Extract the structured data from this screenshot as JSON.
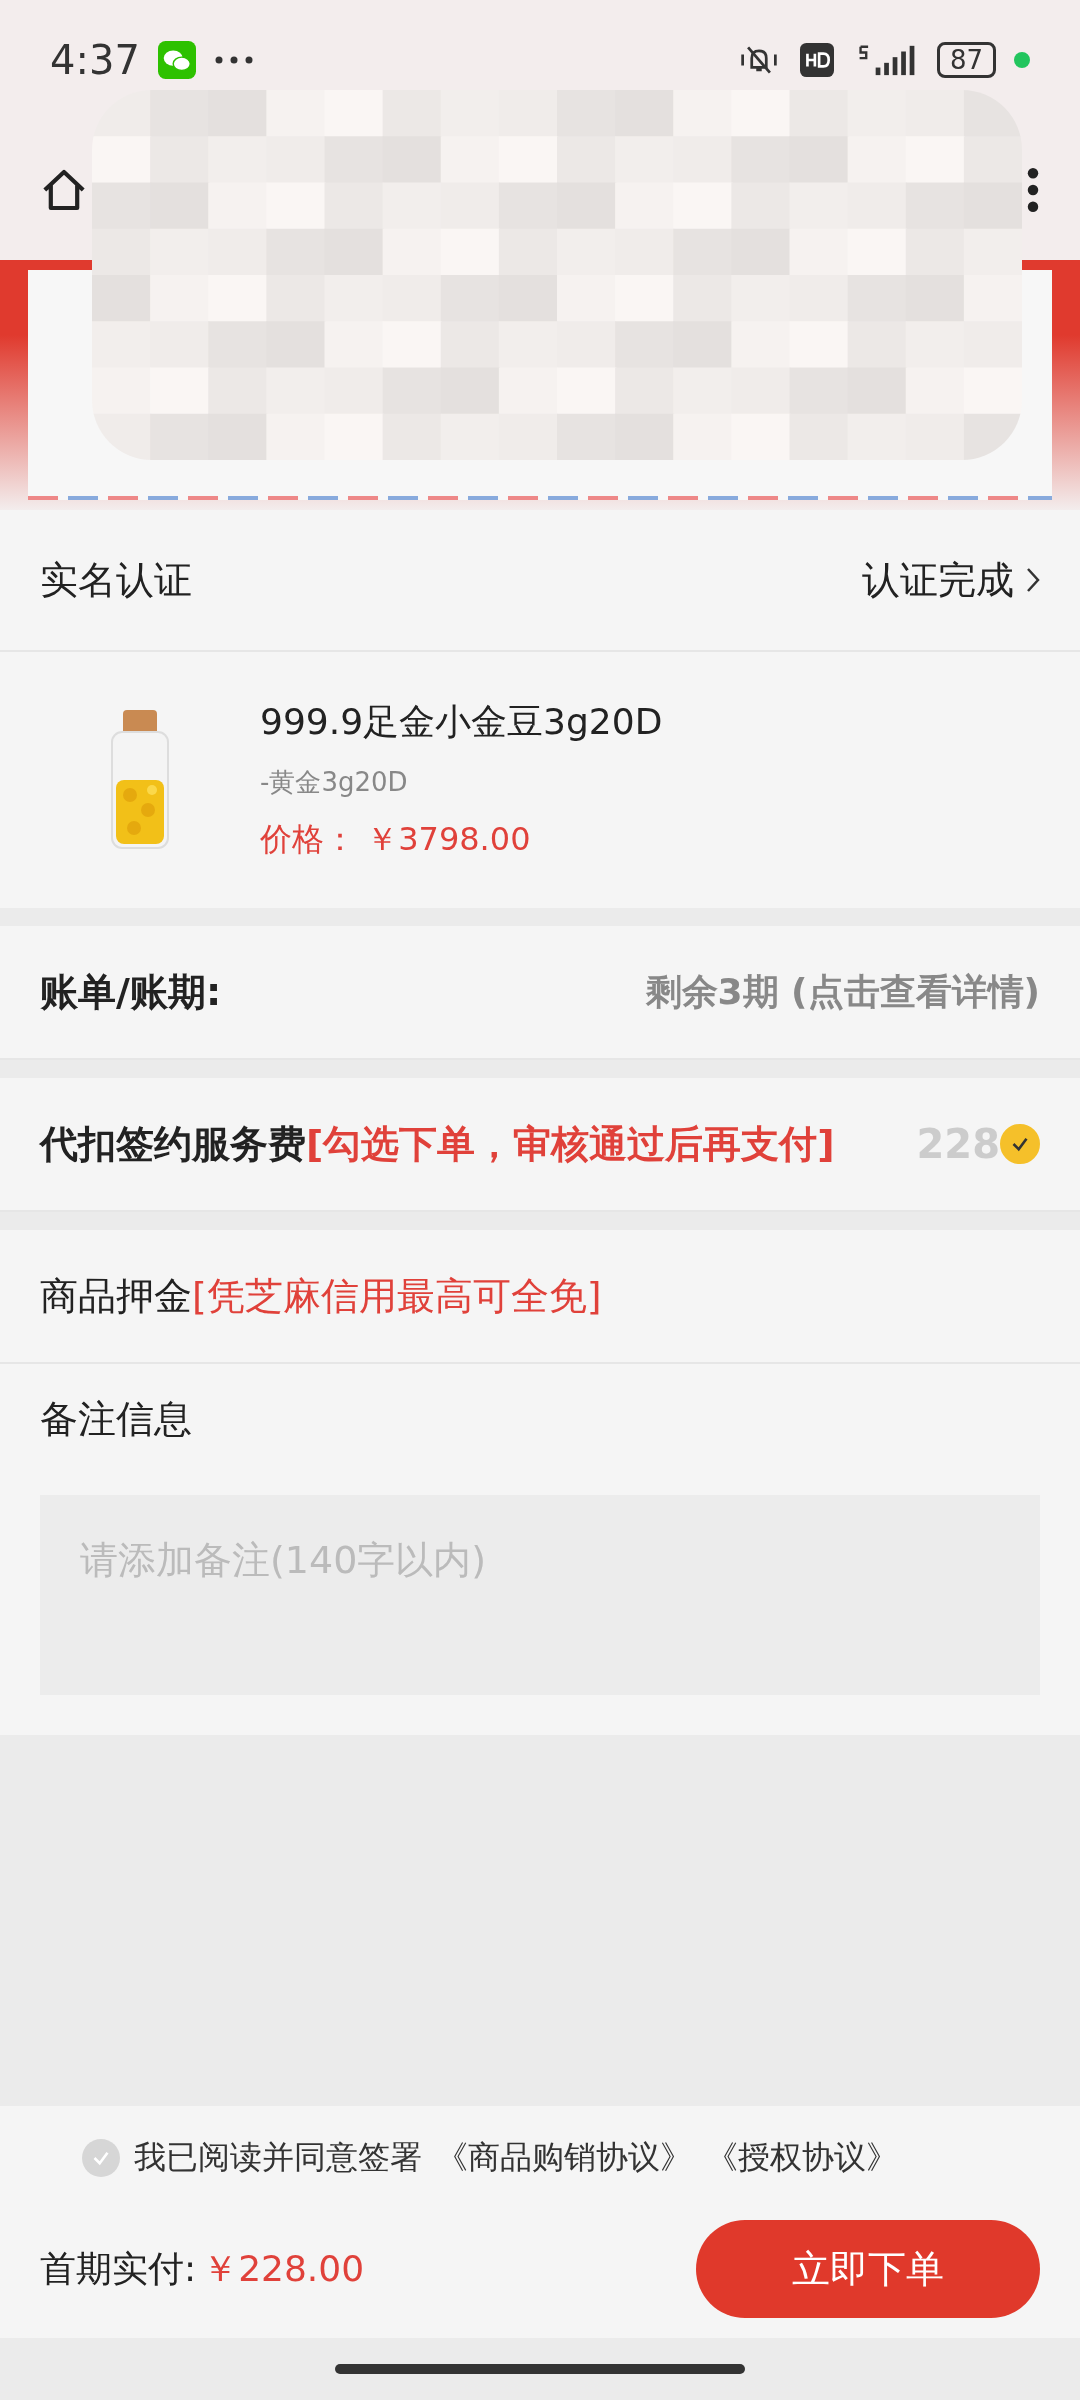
{
  "status_bar": {
    "time": "4:37",
    "battery": "87"
  },
  "verification": {
    "label": "实名认证",
    "value": "认证完成"
  },
  "product": {
    "name": "999.9足金小金豆3g20D",
    "spec": "-黄金3g20D",
    "price_label": "价格：",
    "price": "￥3798.00"
  },
  "bill": {
    "label": "账单/账期:",
    "value": "剩余3期 (点击查看详情)"
  },
  "service_fee": {
    "label": "代扣签约服务费",
    "note": "[勾选下单，审核通过后再支付]",
    "amount": "228",
    "checked": true
  },
  "deposit": {
    "label": "商品押金",
    "note": "[凭芝麻信用最高可全免]"
  },
  "remarks": {
    "label": "备注信息",
    "placeholder": "请添加备注(140字以内)"
  },
  "agreement": {
    "checked": false,
    "text": "我已阅读并同意签署",
    "links": [
      "《商品购销协议》",
      "《授权协议》"
    ]
  },
  "footer": {
    "label": "首期实付:",
    "amount": "￥228.00",
    "button": "立即下单"
  }
}
